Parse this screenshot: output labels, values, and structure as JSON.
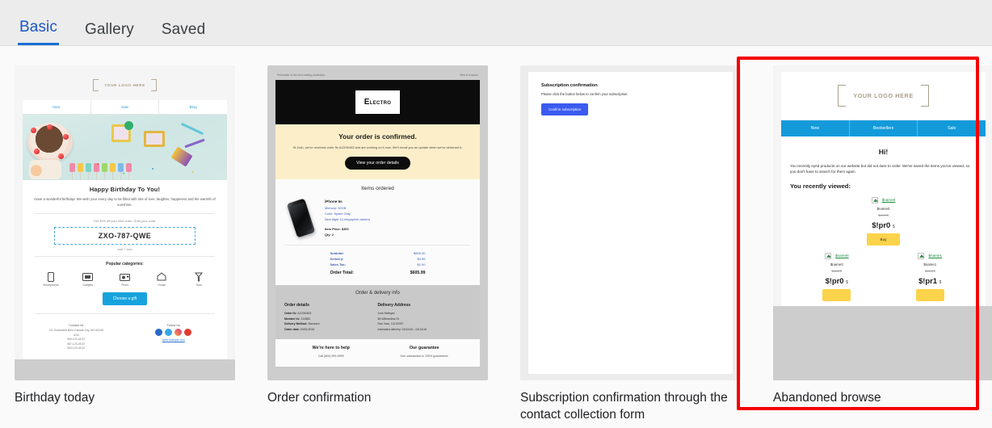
{
  "tabs": [
    {
      "label": "Basic",
      "active": true
    },
    {
      "label": "Gallery",
      "active": false
    },
    {
      "label": "Saved",
      "active": false
    }
  ],
  "highlight": {
    "color": "#f50000",
    "target": "Abandoned browse"
  },
  "cards": [
    {
      "caption": "Birthday today"
    },
    {
      "caption": "Order confirmation"
    },
    {
      "caption": "Subscription confirmation through the contact collection form"
    },
    {
      "caption": "Abandoned browse"
    }
  ],
  "birthday": {
    "logo": "YOUR LOGO HERE",
    "nav": [
      "New",
      "Sale",
      "Blog"
    ],
    "heading": "Happy  Birthday To You!",
    "lead": "Have a wonderful birthday! We wish your every day to be filled with lots of love, laughter, happiness and the warmth of sunshine.",
    "promo": "Get 30% off your next order. Grab your code:",
    "code": "ZXO-787-QWE",
    "valid": "valid 7 days",
    "popular_title": "Popular categories:",
    "categories": [
      {
        "label": "Smartphones",
        "icon": "smartphone-icon"
      },
      {
        "label": "Gadgets",
        "icon": "gadget-icon"
      },
      {
        "label": "Photo",
        "icon": "camera-icon"
      },
      {
        "label": "House",
        "icon": "house-icon"
      },
      {
        "label": "Tools",
        "icon": "tools-icon"
      }
    ],
    "cta": "Choose a gift",
    "contact_title": "Contact Us",
    "contact_lines": [
      "131 Southwest Blvd, Kansas City, MO 64108",
      "USA",
      "065-123-45-67",
      "067-123-45-67",
      "063-123-45-67"
    ],
    "follow_title": "Follow Us",
    "socials": [
      "facebook-icon",
      "twitter-icon",
      "instagram-icon",
      "youtube-icon"
    ],
    "site": "www.example.com"
  },
  "order": {
    "preheader_left": "Preheader of the next mailing provisions.",
    "preheader_right": "View in browser",
    "logo_first": "E",
    "logo_rest": "LECTRO",
    "headline": "Your order is confirmed.",
    "sub": "Hi Josh, we've received order № A1209/453 and are working on it now. We'll email you an update when we've delivered it.",
    "button": "View your order details",
    "items_title": "Items ordered",
    "item": {
      "name": "iPhone 5s",
      "specs": [
        "Memory: 32GB",
        "Color: Space Gray",
        "New 8ight 12-megapixel camera"
      ],
      "price_label": "Item Price: $300",
      "qty_label": "Qty: 2"
    },
    "totals": [
      {
        "label": "Subtotal:",
        "value": "$600.00"
      },
      {
        "label": "Delivery:",
        "value": "$4.99"
      },
      {
        "label": "Sales Tax:",
        "value": "$1.00"
      }
    ],
    "grand": {
      "label": "Order Total:",
      "value": "$605.99"
    },
    "info_title": "Order & delivery info",
    "order_details_title": "Order details",
    "order_details": [
      {
        "k": "Order №:",
        "v": "A1209/453"
      },
      {
        "k": "Member №:",
        "v": "213583"
      },
      {
        "k": "Delivery Method:",
        "v": "Standard"
      },
      {
        "k": "Order date:",
        "v": "03/01/2016"
      }
    ],
    "delivery_title": "Delivery Address",
    "delivery": [
      "Josh Melnyev",
      "56 Willmedina St",
      "San Jose, CA 92937",
      "estimated delivery: 04/10/16 - 04/14/16"
    ],
    "help_title": "We're here to help",
    "help_text": "Call (800) 999-9999",
    "guarantee_title": "Our guarantee",
    "guarantee_text": "Your satisfaction is 100% guaranteed."
  },
  "subscription": {
    "title": "Subscription confirmation",
    "text": "Please click the button below to confirm your subscription.",
    "button": "Confirm subscription"
  },
  "abandoned": {
    "logo": "YOUR LOGO HERE",
    "nav": [
      "New",
      "Bestsellers",
      "Sale"
    ],
    "greeting": "Hi!",
    "intro": "You recently eyed products on our website but did not dare to order. We've saved the items you've viewed, so you don't have to search for them again.",
    "recent_title": "You recently viewed:",
    "buy_label": "Buy",
    "currency": "$",
    "featured": {
      "link": "$name0",
      "name": "$name0",
      "old_price": "$old0 $",
      "price": "$!pr0"
    },
    "products": [
      {
        "link": "$name0",
        "name": "$name0",
        "old_price": "$old0 $",
        "price": "$!pr0"
      },
      {
        "link": "$name1",
        "name": "$name1",
        "old_price": "$old1 $",
        "price": "$!pr1"
      }
    ]
  }
}
